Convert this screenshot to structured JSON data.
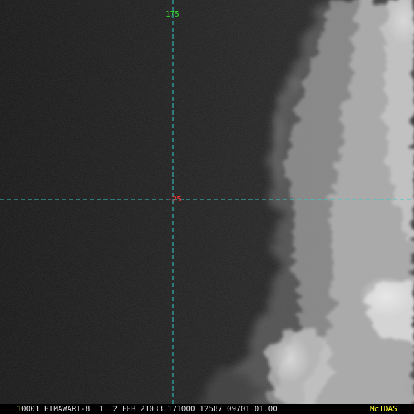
{
  "image": {
    "description_tag": "satellite-visible-imagery"
  },
  "grid": {
    "longitude_label": "175",
    "latitude_label": "-25",
    "longitude_label_color": "#33dd33",
    "latitude_label_color": "#ff3333",
    "line_color": "#33cccc"
  },
  "status_bar": {
    "frame_number": "1",
    "frame_number_color": "#ffff33",
    "text": "0001 HIMAWARI-8  1  2 FEB 21033 171000 12587 09701 01.00",
    "logo_text": "McIDAS",
    "logo_color": "#ffff33"
  },
  "colors": {
    "ocean": "#1c1c1c",
    "cloud": "#cfcfcf"
  }
}
